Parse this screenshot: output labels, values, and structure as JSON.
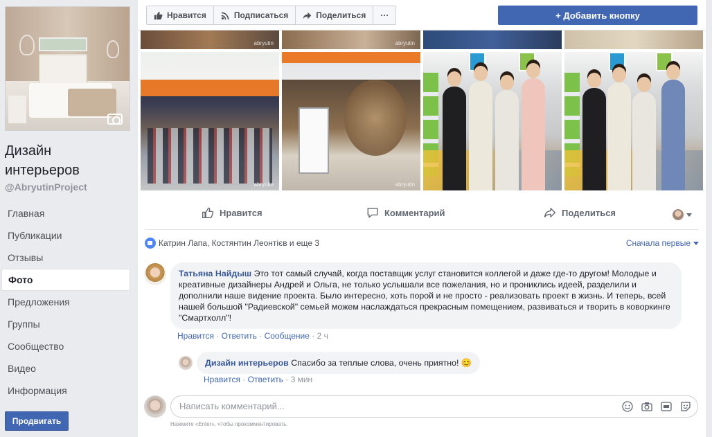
{
  "sidebar": {
    "page_name": "Дизайн интерьеров",
    "handle": "@AbryutinProject",
    "nav": [
      {
        "label": "Главная",
        "active": false
      },
      {
        "label": "Публикации",
        "active": false
      },
      {
        "label": "Отзывы",
        "active": false
      },
      {
        "label": "Фото",
        "active": true
      },
      {
        "label": "Предложения",
        "active": false
      },
      {
        "label": "Группы",
        "active": false
      },
      {
        "label": "Сообщество",
        "active": false
      },
      {
        "label": "Видео",
        "active": false
      },
      {
        "label": "Информация",
        "active": false
      }
    ],
    "promote_label": "Продвигать"
  },
  "toolbar": {
    "like_label": "Нравится",
    "follow_label": "Подписаться",
    "share_label": "Поделиться",
    "more_label": "···",
    "add_button_label": "+ Добавить кнопку"
  },
  "photos": {
    "watermark": "abryutin"
  },
  "post_actions": {
    "like": "Нравится",
    "comment": "Комментарий",
    "share": "Поделиться"
  },
  "reactions": {
    "text": "Катрин Лапа, Костянтин Леонтієв и еще 3",
    "sort_label": "Сначала первые"
  },
  "comments": [
    {
      "author": "Татьяна Найдыш",
      "text": "Это тот самый случай, когда поставщик услуг становится коллегой и даже где-то другом! Молодые и креативные дизайнеры Андрей и Ольга, не только услышали все пожелания, но и прониклись идеей, разделили и дополнили наше видение проекта. Было интересно, хоть порой и не просто - реализовать проект в жизнь. И теперь, всей нашей большой \"Радиевской\" семьей можем наслаждаться прекрасным помещением, развиваться и творить в коворкинге \"Смартхолл\"!",
      "like": "Нравится",
      "reply": "Ответить",
      "message": "Сообщение",
      "time": "2 ч"
    }
  ],
  "reply": {
    "author": "Дизайн интерьеров",
    "text": "Спасибо за теплые слова, очень приятно!",
    "emoji": "😊",
    "like": "Нравится",
    "reply": "Ответить",
    "time": "3 мин"
  },
  "composer": {
    "placeholder": "Написать комментарий...",
    "hint": "Нажмите «Enter», чтобы прокомментировать.",
    "icons": [
      "emoji-icon",
      "camera-icon",
      "gif-icon",
      "sticker-icon"
    ]
  }
}
